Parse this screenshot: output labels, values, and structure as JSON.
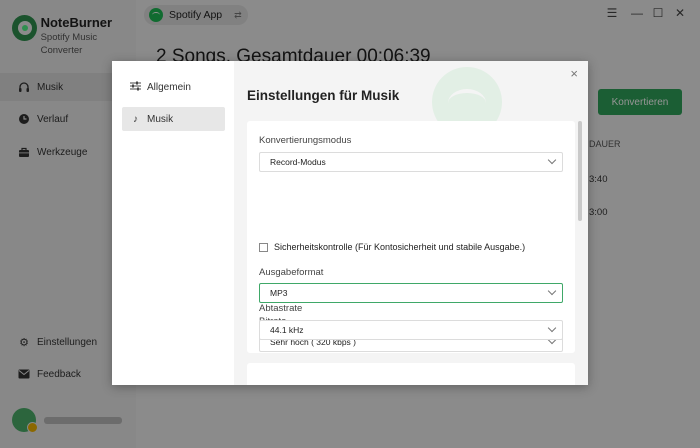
{
  "brand": {
    "name": "NoteBurner",
    "subtitle": "Spotify Music Converter"
  },
  "sidebar": {
    "items": [
      {
        "label": "Musik",
        "icon": "headphones-icon",
        "active": true
      },
      {
        "label": "Verlauf",
        "icon": "clock-icon"
      },
      {
        "label": "Werkzeuge",
        "icon": "toolbox-icon"
      }
    ],
    "bottom_items": [
      {
        "label": "Einstellungen",
        "icon": "gear-icon"
      },
      {
        "label": "Feedback",
        "icon": "mail-icon"
      }
    ]
  },
  "topbar": {
    "app_label": "Spotify App",
    "swap_icon": "⇄"
  },
  "window_controls": {
    "menu": "☰",
    "minimize": "—",
    "maximize": "☐",
    "close": "✕"
  },
  "main": {
    "title": "2 Songs, Gesamtdauer 00:06:39",
    "convert_label": "Konvertieren",
    "column_header": "DAUER",
    "durations": [
      "3:40",
      "3:00"
    ]
  },
  "dialog": {
    "title": "Einstellungen für Musik",
    "close_glyph": "×",
    "tabs": [
      {
        "label": "Allgemein",
        "icon": "sliders-icon"
      },
      {
        "label": "Musik",
        "icon": "music-note-icon",
        "active": true
      }
    ],
    "fields": {
      "mode_label": "Konvertierungsmodus",
      "mode_value": "Record-Modus",
      "safety_label": "Sicherheitskontrolle (Für Kontosicherheit und stabile Ausgabe.)",
      "format_label": "Ausgabeformat",
      "format_value": "MP3",
      "bitrate_label": "Bitrate",
      "bitrate_value": "Sehr hoch ( 320 kbps )",
      "samplerate_label": "Abtastrate",
      "samplerate_value": "44.1 kHz"
    }
  },
  "colors": {
    "accent": "#2fa35a",
    "focus_border": "#3fa868"
  }
}
